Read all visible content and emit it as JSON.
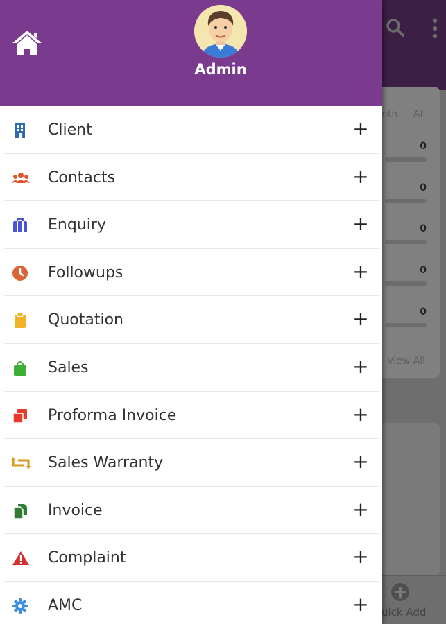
{
  "background": {
    "tabs": [
      "nth",
      "All"
    ],
    "counts": [
      "0",
      "0",
      "0",
      "0",
      "0"
    ],
    "view_all": "View All",
    "quick_add": "uick Add"
  },
  "drawer": {
    "user_name": "Admin",
    "colors": {
      "header": "#7a3b8e",
      "text": "#333333"
    },
    "menu": [
      {
        "label": "Client",
        "icon": "building-icon",
        "color": "#2b6cb3"
      },
      {
        "label": "Contacts",
        "icon": "users-icon",
        "color": "#e0562a"
      },
      {
        "label": "Enquiry",
        "icon": "briefcase-icon",
        "color": "#4a55d6"
      },
      {
        "label": "Followups",
        "icon": "clock-icon",
        "color": "#d9663a"
      },
      {
        "label": "Quotation",
        "icon": "clipboard-icon",
        "color": "#f0b429"
      },
      {
        "label": "Sales",
        "icon": "shopping-bag-icon",
        "color": "#3cb035"
      },
      {
        "label": "Proforma Invoice",
        "icon": "copy-icon",
        "color": "#e53b2c"
      },
      {
        "label": "Sales Warranty",
        "icon": "retweet-icon",
        "color": "#d99a1b"
      },
      {
        "label": "Invoice",
        "icon": "files-icon",
        "color": "#2e7d32"
      },
      {
        "label": "Complaint",
        "icon": "warning-icon",
        "color": "#d32f2f"
      },
      {
        "label": "AMC",
        "icon": "gear-icon",
        "color": "#3f8fe0"
      }
    ],
    "expand_symbol": "+"
  }
}
